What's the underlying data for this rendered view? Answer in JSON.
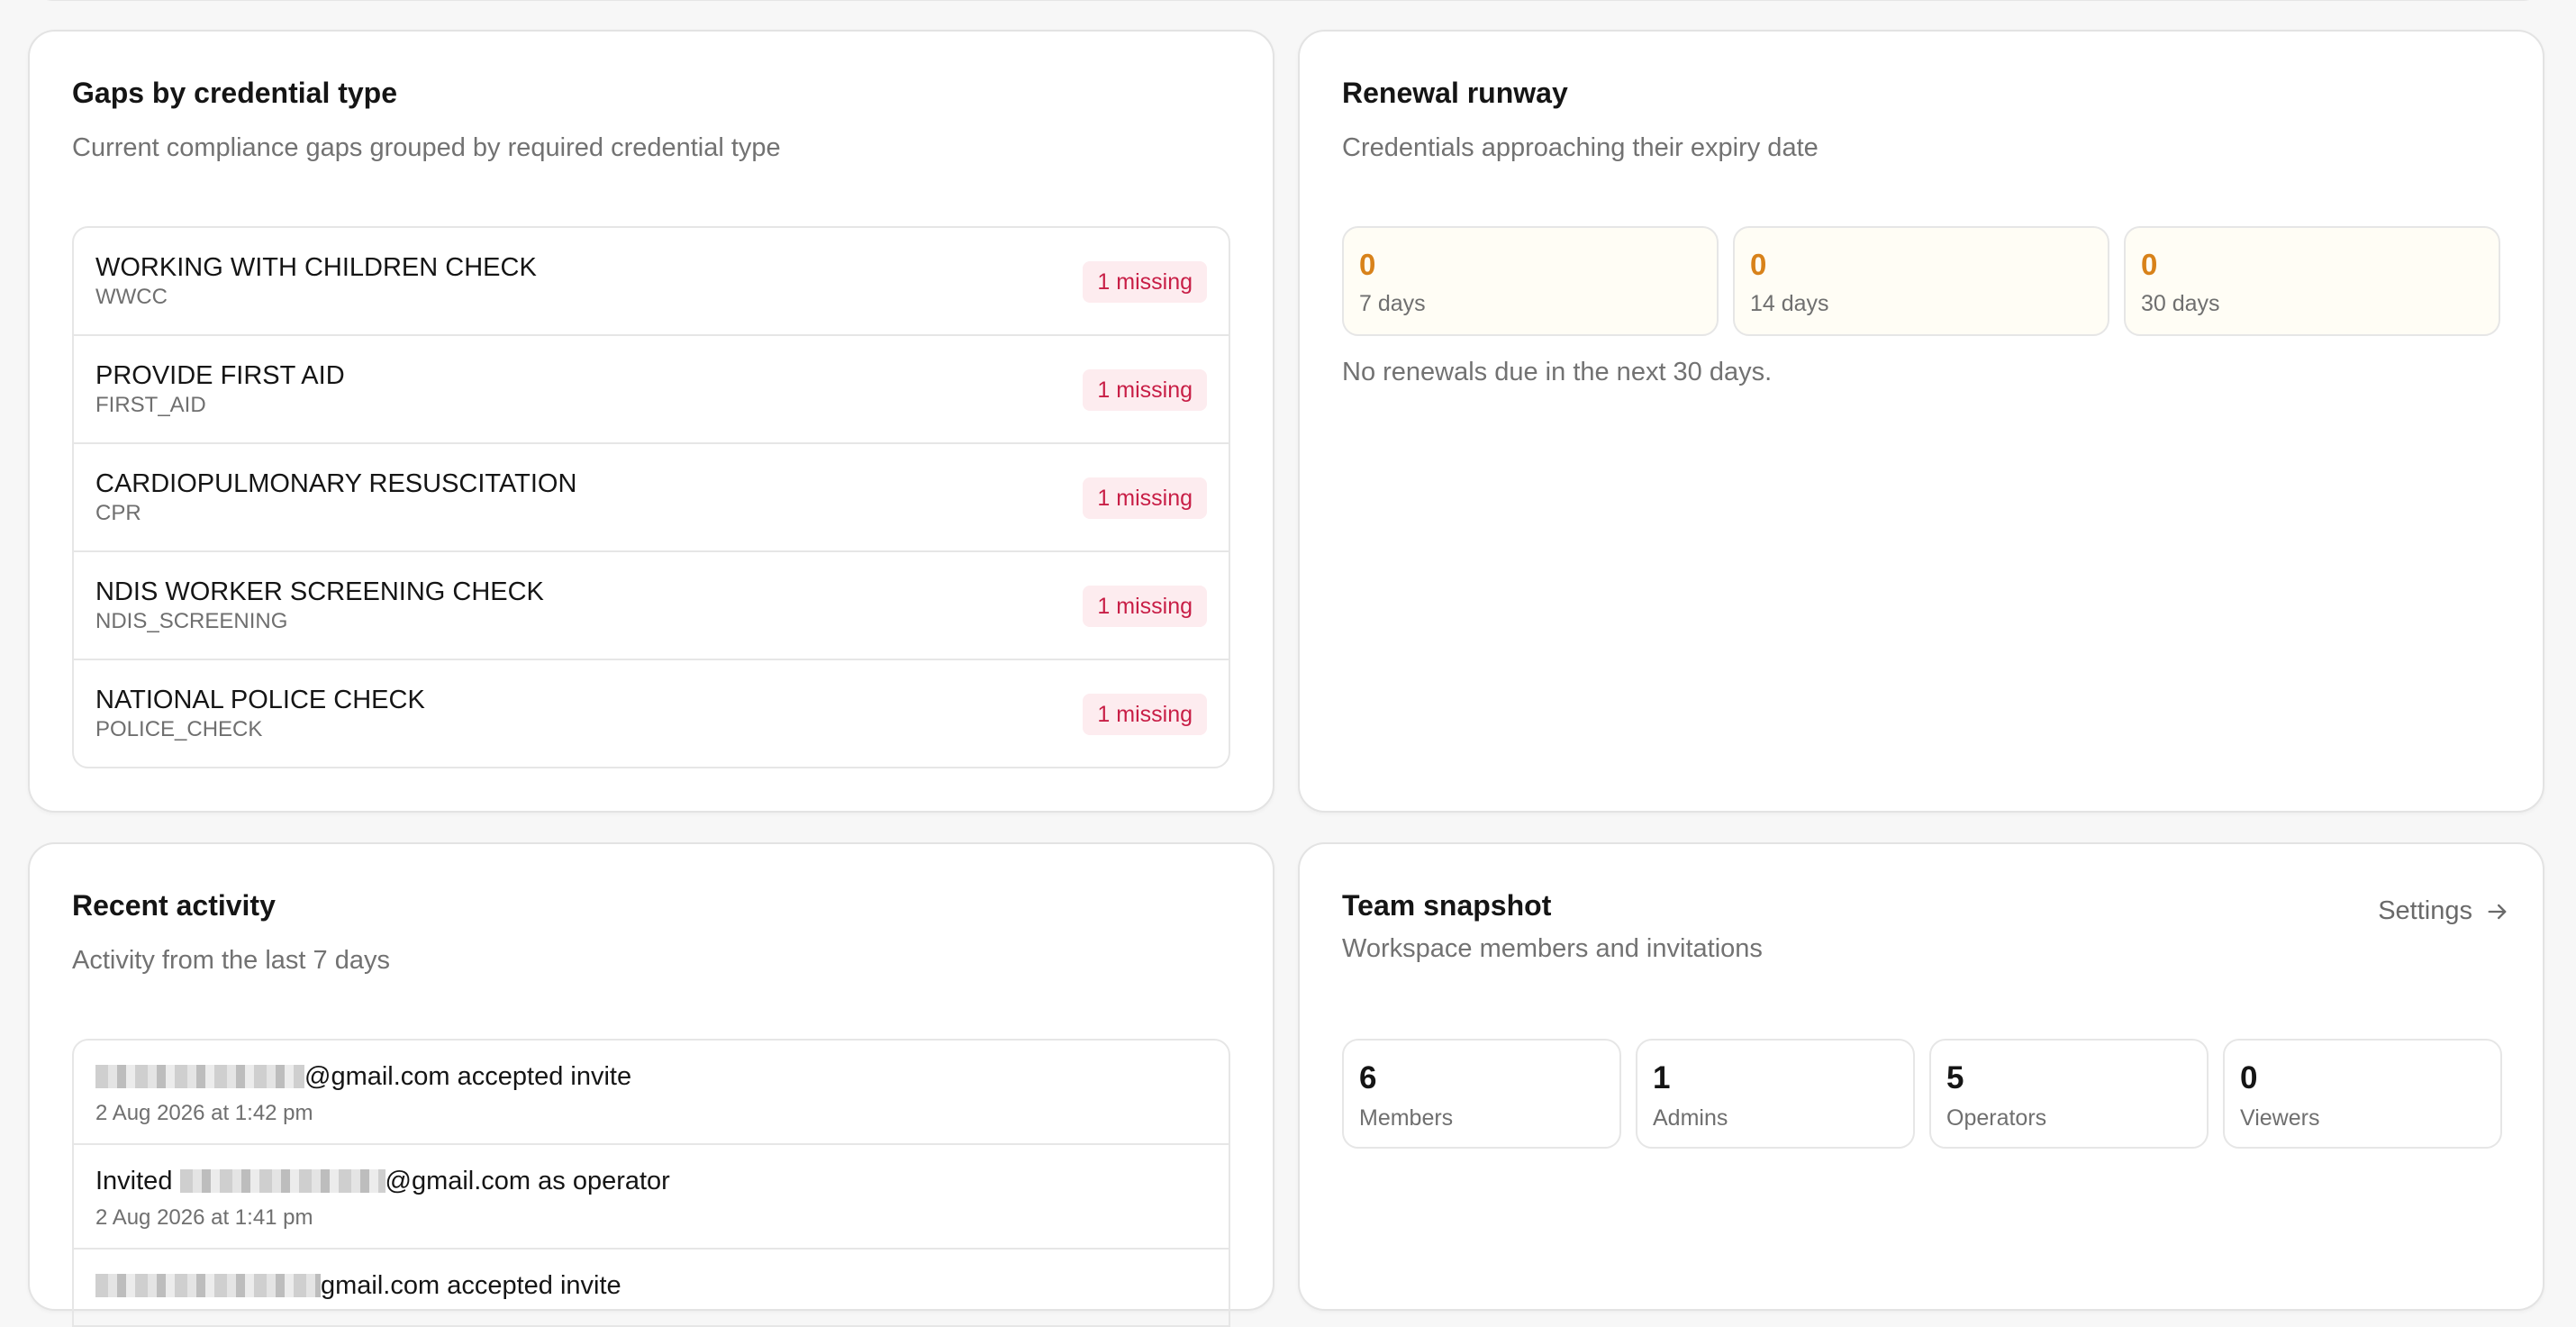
{
  "gaps": {
    "title": "Gaps by credential type",
    "subtitle": "Current compliance gaps grouped by required credential type",
    "items": [
      {
        "name": "WORKING WITH CHILDREN CHECK",
        "code": "WWCC",
        "badge": "1 missing"
      },
      {
        "name": "PROVIDE FIRST AID",
        "code": "FIRST_AID",
        "badge": "1 missing"
      },
      {
        "name": "CARDIOPULMONARY RESUSCITATION",
        "code": "CPR",
        "badge": "1 missing"
      },
      {
        "name": "NDIS WORKER SCREENING CHECK",
        "code": "NDIS_SCREENING",
        "badge": "1 missing"
      },
      {
        "name": "NATIONAL POLICE CHECK",
        "code": "POLICE_CHECK",
        "badge": "1 missing"
      }
    ]
  },
  "renewal": {
    "title": "Renewal runway",
    "subtitle": "Credentials approaching their expiry date",
    "buckets": [
      {
        "count": "0",
        "label": "7 days"
      },
      {
        "count": "0",
        "label": "14 days"
      },
      {
        "count": "0",
        "label": "30 days"
      }
    ],
    "empty_message": "No renewals due in the next 30 days."
  },
  "activity": {
    "title": "Recent activity",
    "subtitle": "Activity from the last 7 days",
    "items": [
      {
        "prefix": "",
        "suffix": "@gmail.com accepted invite",
        "time": "2 Aug 2026 at 1:42 pm"
      },
      {
        "prefix": "Invited ",
        "suffix": "@gmail.com as operator",
        "time": "2 Aug 2026 at 1:41 pm"
      },
      {
        "prefix": "",
        "suffix": "gmail.com accepted invite",
        "time": ""
      }
    ]
  },
  "team": {
    "title": "Team snapshot",
    "subtitle": "Workspace members and invitations",
    "settings_label": "Settings",
    "stats": [
      {
        "count": "6",
        "label": "Members"
      },
      {
        "count": "1",
        "label": "Admins"
      },
      {
        "count": "5",
        "label": "Operators"
      },
      {
        "count": "0",
        "label": "Viewers"
      }
    ]
  },
  "colors": {
    "missing_badge_text": "#c81e46",
    "missing_badge_bg": "#fdecef",
    "runway_count": "#d8821a",
    "runway_bg": "#fffdf5"
  }
}
